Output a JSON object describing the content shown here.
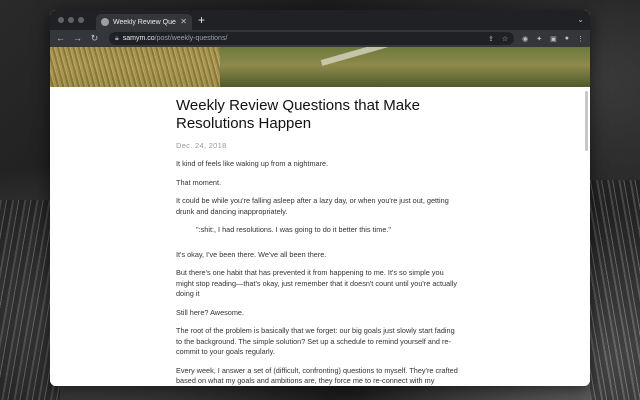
{
  "browser": {
    "tab_title": "Weekly Review Questions tha",
    "url_domain": "samym.co",
    "url_path": "/post/weekly-questions/"
  },
  "article": {
    "title": "Weekly Review Questions that Make Resolutions Happen",
    "date": "Dec. 24, 2018",
    "paragraphs": [
      "It kind of feels like waking up from a nightmare.",
      "That moment.",
      "It could be while you're falling asleep after a lazy day, or when you're just out, getting drunk and dancing inappropriately.",
      "It's okay, I've been there. We've all been there.",
      "But there's one habit that has prevented it from happening to me. It's so simple you might stop reading—that's okay, just remember that it doesn't count until you're actually doing it",
      "Still here? Awesome.",
      "The root of the problem is basically that we forget: our big goals just slowly start fading to the background. The simple solution? Set up a schedule to remind yourself and re-commit to your goals regularly.",
      "Every week, I answer a set of (difficult, confronting) questions to myself. They're crafted based on what my goals and ambitions are, they force me to re-connect with my resolutions every single week, so I can get a fresh start every Sunday."
    ],
    "quote": "\":shit:, I had resolutions. I was going to do it better this time.\""
  }
}
